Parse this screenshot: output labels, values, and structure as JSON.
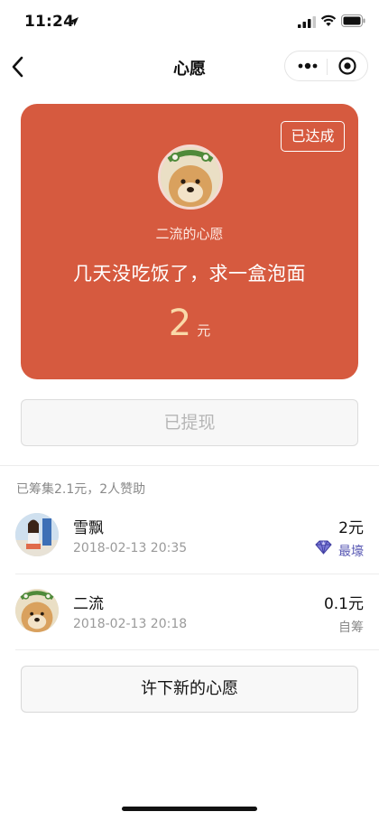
{
  "status_bar": {
    "time": "11:24"
  },
  "nav": {
    "title": "心愿"
  },
  "wish_card": {
    "status_badge": "已达成",
    "owner_label": "二流的心愿",
    "wish_text": "几天没吃饭了，求一盒泡面",
    "amount": "2",
    "amount_unit": "元",
    "background_color": "#d65a3f"
  },
  "withdraw_button": {
    "label": "已提现"
  },
  "raise_summary": "已筹集2.1元，2人赞助",
  "supporters": [
    {
      "name": "雪飘",
      "time": "2018-02-13 20:35",
      "amount": "2元",
      "tag": "最壕",
      "tag_icon": "diamond-icon"
    },
    {
      "name": "二流",
      "time": "2018-02-13 20:18",
      "amount": "0.1元",
      "tag": "自筹"
    }
  ],
  "new_wish_button": {
    "label": "许下新的心愿"
  }
}
